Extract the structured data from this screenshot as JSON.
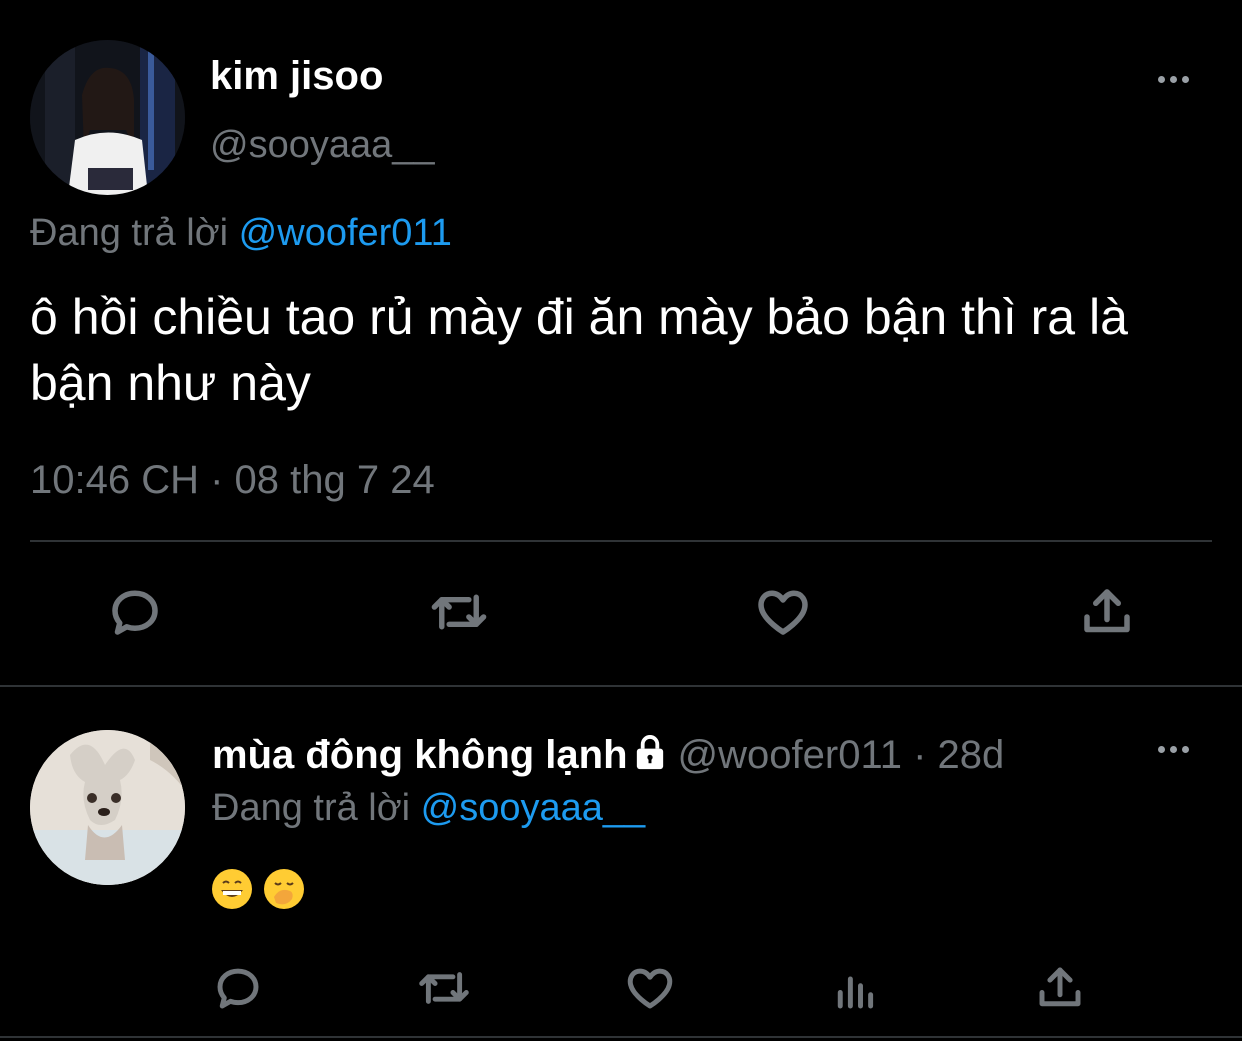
{
  "main_tweet": {
    "name": "kim jisoo",
    "handle": "@sooyaaa__",
    "reply_prefix": "Đang trả lời",
    "reply_mention": "@woofer011",
    "text": "ô hồi chiều tao rủ mày đi ăn mày bảo bận thì ra là bận như này",
    "timestamp": "10:46 CH · 08 thg 7 24",
    "actions": [
      "reply-icon",
      "retweet-icon",
      "like-icon",
      "share-icon"
    ]
  },
  "reply_tweet": {
    "name": "mùa đông không lạnh",
    "handle": "@woofer011",
    "time": "· 28d",
    "reply_prefix": "Đang trả lời",
    "reply_mention": "@sooyaaa__",
    "emojis": [
      "grinning-face-emoji",
      "face-with-hand-over-mouth-emoji"
    ],
    "actions": [
      "reply-icon",
      "retweet-icon",
      "like-icon",
      "views-icon",
      "share-icon"
    ]
  },
  "colors": {
    "background": "#000000",
    "text": "#e7e9ea",
    "secondary": "#71767b",
    "accent": "#1d9bf0",
    "divider": "#2f3336"
  }
}
